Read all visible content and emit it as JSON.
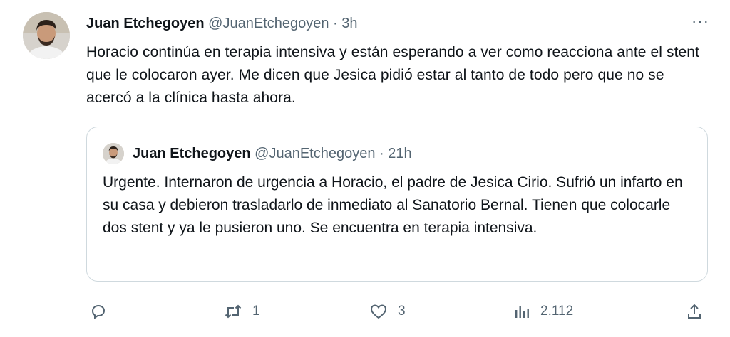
{
  "tweet": {
    "author_name": "Juan Etchegoyen",
    "handle": "@JuanEtchegoyen",
    "separator": "·",
    "time": "3h",
    "more_label": "···",
    "text": "Horacio continúa en terapia intensiva y están esperando a ver como reacciona ante el stent que le colocaron ayer. Me dicen que Jesica pidió estar al tanto de todo pero que no se acercó a la clínica hasta ahora."
  },
  "quoted": {
    "author_name": "Juan Etchegoyen",
    "handle": "@JuanEtchegoyen",
    "separator": "·",
    "time": "21h",
    "text": "Urgente. Internaron de urgencia a Horacio, el padre de Jesica Cirio. Sufrió un infarto en su casa y debieron trasladarlo de inmediato al Sanatorio Bernal. Tienen que colocarle dos stent y ya le pusieron uno. Se encuentra en terapia intensiva."
  },
  "actions": {
    "reply_count": "",
    "retweet_count": "1",
    "like_count": "3",
    "views_count": "2.112"
  },
  "icons": {
    "reply": "reply-icon",
    "retweet": "retweet-icon",
    "like": "like-icon",
    "views": "views-icon",
    "share": "share-icon",
    "more": "more-icon"
  },
  "colors": {
    "text": "#0f1419",
    "secondary": "#536471",
    "border": "#cfd9de"
  }
}
